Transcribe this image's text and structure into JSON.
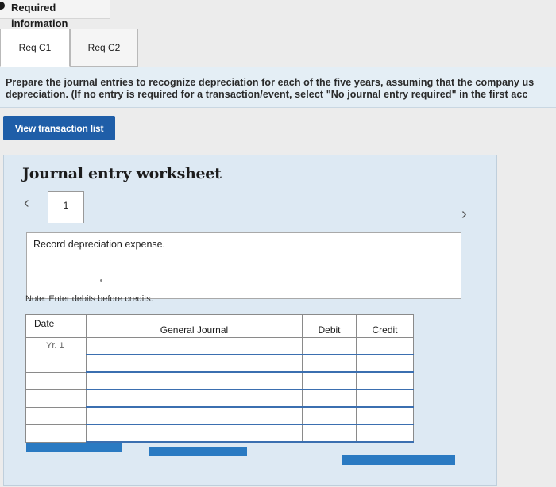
{
  "header": {
    "required_info_label": "Required information"
  },
  "tabs": [
    {
      "label": "Req C1",
      "active": true
    },
    {
      "label": "Req C2",
      "active": false
    }
  ],
  "instructions": {
    "line1": "Prepare the journal entries to recognize depreciation for each of the five years, assuming that the company us",
    "line2": "depreciation. (If no entry is required for a transaction/event, select \"No journal entry required\" in the first acc"
  },
  "view_transaction_button": "View transaction list",
  "worksheet": {
    "title": "Journal entry worksheet",
    "current_entry": "1",
    "description": "Record depreciation expense.",
    "note": "Note: Enter debits before credits.",
    "table": {
      "columns": [
        "Date",
        "General Journal",
        "Debit",
        "Credit"
      ],
      "rows": [
        {
          "date": "Yr. 1",
          "account": "",
          "debit": "",
          "credit": ""
        },
        {
          "date": "",
          "account": "",
          "debit": "",
          "credit": ""
        },
        {
          "date": "",
          "account": "",
          "debit": "",
          "credit": ""
        },
        {
          "date": "",
          "account": "",
          "debit": "",
          "credit": ""
        },
        {
          "date": "",
          "account": "",
          "debit": "",
          "credit": ""
        },
        {
          "date": "",
          "account": "",
          "debit": "",
          "credit": ""
        }
      ]
    }
  },
  "colors": {
    "accent": "#1f5ea8",
    "panel": "#dde9f3",
    "instructions_bg": "#e4eef5"
  }
}
